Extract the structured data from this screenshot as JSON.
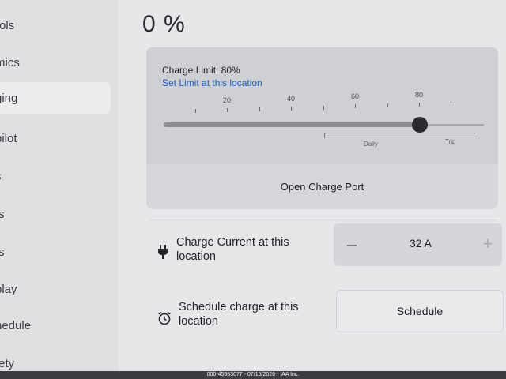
{
  "sidebar": {
    "items": [
      {
        "label": "rols",
        "active": false
      },
      {
        "label": "mics",
        "active": false
      },
      {
        "label": "ging",
        "active": true
      },
      {
        "label": "pilot",
        "active": false
      },
      {
        "label": "s",
        "active": false
      },
      {
        "label": "ts",
        "active": false
      },
      {
        "label": "ts",
        "active": false
      },
      {
        "label": "play",
        "active": false
      },
      {
        "label": "nedule",
        "active": false
      },
      {
        "label": "fety",
        "active": false
      }
    ]
  },
  "battery": {
    "percent_label": "0 %"
  },
  "charge_limit": {
    "title": "Charge Limit: 80%",
    "set_limit_link": "Set Limit at this location",
    "value_percent": 80,
    "ticks": [
      "20",
      "40",
      "60",
      "80"
    ],
    "daily_label": "Daily",
    "trip_label": "Trip"
  },
  "charge_port": {
    "button_label": "Open Charge Port"
  },
  "charge_current": {
    "label_line1": "Charge Current at this",
    "label_line2": "location",
    "minus_label": "–",
    "value": "32  A",
    "plus_label": "+"
  },
  "schedule": {
    "label_line1": "Schedule charge at this",
    "label_line2": "location",
    "button_label": "Schedule"
  },
  "footer": {
    "watermark": "000-45583077 - 07/15/2026 - IAA Inc."
  },
  "colors": {
    "link": "#1b5ec9",
    "knob": "#2a2b2e",
    "background": "#e6e7e9"
  },
  "icons": {
    "plug": "plug-icon",
    "clock": "alarm-clock-icon"
  }
}
